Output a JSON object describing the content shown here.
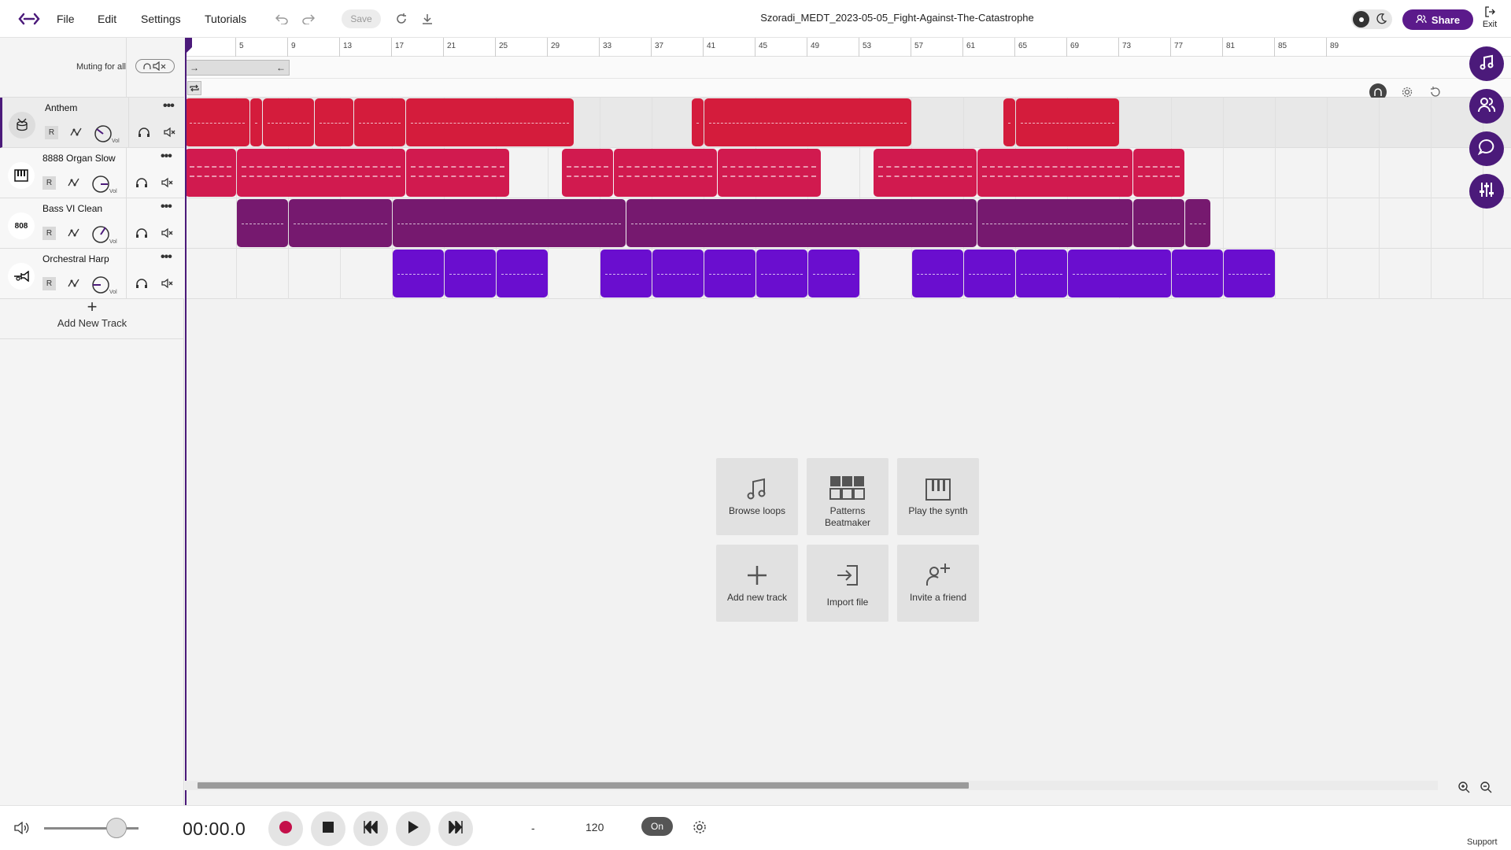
{
  "menu": {
    "file": "File",
    "edit": "Edit",
    "settings": "Settings",
    "tutorials": "Tutorials"
  },
  "toolbar": {
    "save_label": "Save"
  },
  "project": {
    "title": "Szoradi_MEDT_2023-05-05_Fight-Against-The-Catastrophe"
  },
  "share": {
    "label": "Share"
  },
  "exit": {
    "label": "Exit"
  },
  "muting": {
    "label": "Muting for all"
  },
  "tracks": [
    {
      "name": "Anthem",
      "icon": "drum-icon",
      "color": "#d41c3c",
      "r": "R",
      "vol": "Vol"
    },
    {
      "name": "8888 Organ Slow",
      "icon": "piano-icon",
      "color": "#d11a4f",
      "r": "R",
      "vol": "Vol"
    },
    {
      "name": "Bass VI Clean",
      "icon": "808",
      "color": "#76196f",
      "r": "R",
      "vol": "Vol"
    },
    {
      "name": "Orchestral Harp",
      "icon": "trumpet-icon",
      "color": "#6a0ecf",
      "r": "R",
      "vol": "Vol"
    }
  ],
  "add_track": {
    "label": "Add New Track"
  },
  "ruler": {
    "bars": [
      "5",
      "9",
      "13",
      "17",
      "21",
      "25",
      "29",
      "33",
      "37",
      "41",
      "45",
      "49",
      "53",
      "57",
      "61",
      "65",
      "69",
      "73",
      "77",
      "81",
      "85",
      "89"
    ]
  },
  "quick_actions": {
    "browse": "Browse loops",
    "patterns": "Patterns Beatmaker",
    "synth": "Play the synth",
    "add_track": "Add new track",
    "import": "Import file",
    "invite": "Invite a friend"
  },
  "transport": {
    "time": "00:00.0",
    "dash": "-",
    "bpm": "120",
    "metronome": "On",
    "support": "Support"
  },
  "colors": {
    "accent": "#4b1a7a"
  }
}
